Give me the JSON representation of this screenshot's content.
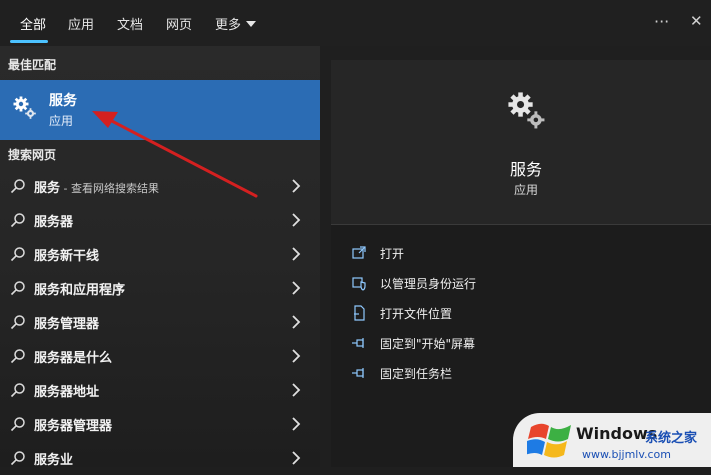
{
  "tabs": [
    {
      "label": "全部",
      "active": true
    },
    {
      "label": "应用"
    },
    {
      "label": "文档"
    },
    {
      "label": "网页"
    },
    {
      "label": "更多"
    }
  ],
  "top_icons": {
    "more_options": "···",
    "close": "✕"
  },
  "sections": {
    "best_match": "最佳匹配",
    "web_search": "搜索网页"
  },
  "best_match": {
    "title": "服务",
    "subtitle": "应用",
    "icon": "gear-icon"
  },
  "web_results": [
    {
      "label": "服务",
      "suffix": " - 查看网络搜索结果"
    },
    {
      "label": "服务器"
    },
    {
      "label": "服务新干线"
    },
    {
      "label": "服务和应用程序"
    },
    {
      "label": "服务管理器"
    },
    {
      "label": "服务器是什么"
    },
    {
      "label": "服务器地址"
    },
    {
      "label": "服务器管理器"
    },
    {
      "label": "服务业"
    }
  ],
  "preview": {
    "title": "服务",
    "subtitle": "应用"
  },
  "actions": [
    {
      "label": "打开",
      "icon": "open-icon"
    },
    {
      "label": "以管理员身份运行",
      "icon": "shield-icon"
    },
    {
      "label": "打开文件位置",
      "icon": "file-location-icon"
    },
    {
      "label": "固定到\"开始\"屏幕",
      "icon": "pin-icon"
    },
    {
      "label": "固定到任务栏",
      "icon": "pin-icon"
    }
  ],
  "watermark": {
    "brand": "Windows",
    "cn": "系统之家",
    "url": "www.bjjmlv.com"
  },
  "colors": {
    "accent": "#4cc2ff",
    "selection": "#2b6cb4",
    "annotation_arrow": "#d42020"
  }
}
